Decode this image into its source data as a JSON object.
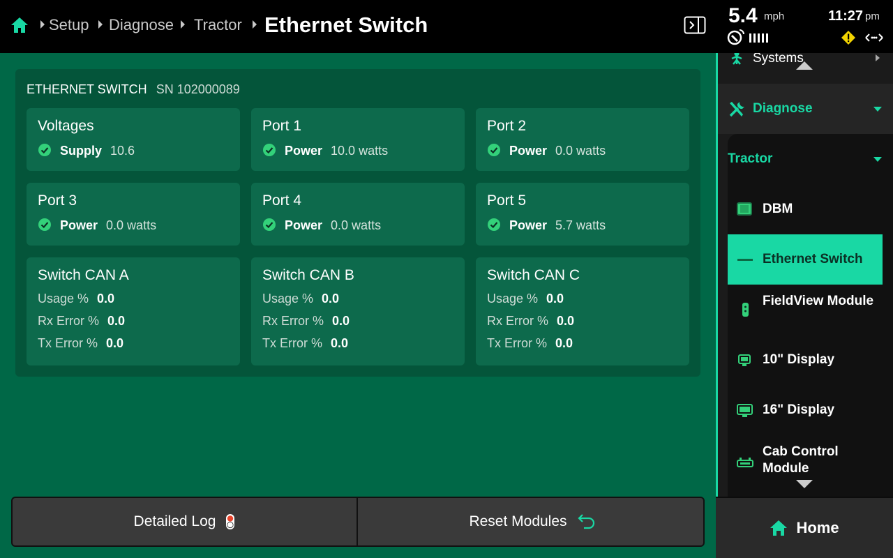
{
  "header": {
    "breadcrumbs": [
      "Setup",
      "Diagnose",
      "Tractor"
    ],
    "title": "Ethernet Switch"
  },
  "status": {
    "speed_value": "5.4",
    "speed_unit": "mph",
    "time": "11:27",
    "ampm": "pm"
  },
  "card": {
    "name": "ETHERNET SWITCH",
    "serial": "SN 102000089",
    "tiles": [
      {
        "title": "Voltages",
        "label": "Supply",
        "value": "10.6"
      },
      {
        "title": "Port 1",
        "label": "Power",
        "value": "10.0 watts"
      },
      {
        "title": "Port 2",
        "label": "Power",
        "value": "0.0 watts"
      },
      {
        "title": "Port 3",
        "label": "Power",
        "value": "0.0 watts"
      },
      {
        "title": "Port 4",
        "label": "Power",
        "value": "0.0 watts"
      },
      {
        "title": "Port 5",
        "label": "Power",
        "value": "5.7 watts"
      }
    ],
    "can": [
      {
        "title": "Switch CAN A",
        "usage_label": "Usage %",
        "usage": "0.0",
        "rx_label": "Rx Error %",
        "rx": "0.0",
        "tx_label": "Tx Error %",
        "tx": "0.0"
      },
      {
        "title": "Switch CAN B",
        "usage_label": "Usage %",
        "usage": "0.0",
        "rx_label": "Rx Error %",
        "rx": "0.0",
        "tx_label": "Tx Error %",
        "tx": "0.0"
      },
      {
        "title": "Switch CAN C",
        "usage_label": "Usage %",
        "usage": "0.0",
        "rx_label": "Rx Error %",
        "rx": "0.0",
        "tx_label": "Tx Error %",
        "tx": "0.0"
      }
    ]
  },
  "buttons": {
    "detailed_log": "Detailed Log",
    "reset_modules": "Reset Modules"
  },
  "sidebar": {
    "systems": "Systems",
    "diagnose": "Diagnose",
    "tractor": "Tractor",
    "items": [
      {
        "label": "DBM",
        "icon": "dbm-icon"
      },
      {
        "label": "Ethernet Switch",
        "icon": "ethernet-switch-icon",
        "active": true
      },
      {
        "label": "FieldView Module",
        "icon": "fieldview-module-icon"
      },
      {
        "label": "10\" Display",
        "icon": "display-10-icon"
      },
      {
        "label": "16\" Display",
        "icon": "display-16-icon"
      },
      {
        "label": "Cab Control Module",
        "icon": "cab-control-icon"
      }
    ],
    "home": "Home"
  },
  "colors": {
    "accent": "#19d8a4",
    "main_bg": "#006847",
    "card_bg": "#04553a",
    "tile_bg": "#0d6a4c",
    "ok_green": "#33d17a",
    "warning": "#f2d300"
  }
}
